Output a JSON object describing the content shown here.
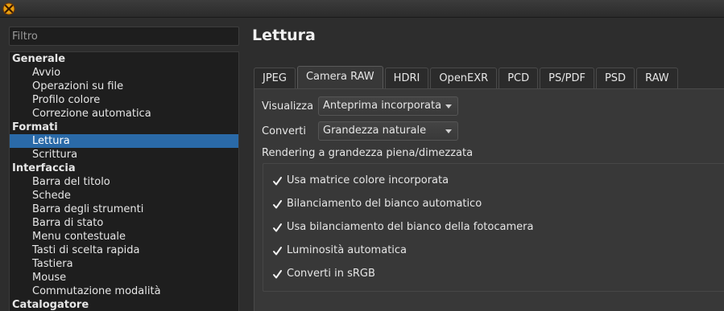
{
  "app_icon": "app-logo-icon",
  "filter": {
    "placeholder": "Filtro",
    "value": ""
  },
  "tree": [
    {
      "label": "Generale",
      "kind": "cat"
    },
    {
      "label": "Avvio",
      "kind": "child"
    },
    {
      "label": "Operazioni su file",
      "kind": "child"
    },
    {
      "label": "Profilo colore",
      "kind": "child"
    },
    {
      "label": "Correzione automatica",
      "kind": "child"
    },
    {
      "label": "Formati",
      "kind": "cat"
    },
    {
      "label": "Lettura",
      "kind": "child",
      "selected": true
    },
    {
      "label": "Scrittura",
      "kind": "child"
    },
    {
      "label": "Interfaccia",
      "kind": "cat"
    },
    {
      "label": "Barra del titolo",
      "kind": "child"
    },
    {
      "label": "Schede",
      "kind": "child"
    },
    {
      "label": "Barra degli strumenti",
      "kind": "child"
    },
    {
      "label": "Barra di stato",
      "kind": "child"
    },
    {
      "label": "Menu contestuale",
      "kind": "child"
    },
    {
      "label": "Tasti di scelta rapida",
      "kind": "child"
    },
    {
      "label": "Tastiera",
      "kind": "child"
    },
    {
      "label": "Mouse",
      "kind": "child"
    },
    {
      "label": "Commutazione modalità",
      "kind": "child"
    },
    {
      "label": "Catalogatore",
      "kind": "cat"
    }
  ],
  "page_title": "Lettura",
  "tabs": [
    {
      "label": "JPEG"
    },
    {
      "label": "Camera RAW",
      "active": true
    },
    {
      "label": "HDRI"
    },
    {
      "label": "OpenEXR"
    },
    {
      "label": "PCD"
    },
    {
      "label": "PS/PDF"
    },
    {
      "label": "PSD"
    },
    {
      "label": "RAW"
    }
  ],
  "visualizza": {
    "label": "Visualizza",
    "value": "Anteprima incorporata"
  },
  "converti": {
    "label": "Converti",
    "value": "Grandezza naturale"
  },
  "rendering_label": "Rendering a grandezza piena/dimezzata",
  "checkboxes": [
    {
      "label": "Usa matrice colore incorporata",
      "checked": true
    },
    {
      "label": "Bilanciamento del bianco automatico",
      "checked": true
    },
    {
      "label": "Usa bilanciamento del bianco della fotocamera",
      "checked": true
    },
    {
      "label": "Luminosità automatica",
      "checked": true
    },
    {
      "label": "Converti in sRGB",
      "checked": true
    }
  ],
  "colors": {
    "selection": "#2a6aa8",
    "background": "#2d2d2d",
    "panel": "#383838"
  }
}
